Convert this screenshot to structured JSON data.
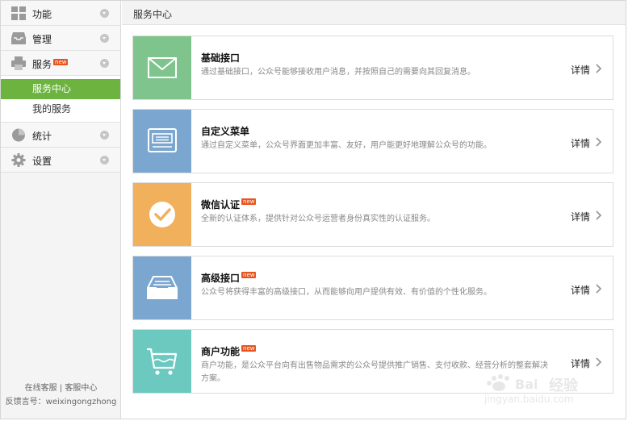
{
  "sidebar": {
    "groups": [
      {
        "label": "功能",
        "icon": "grid-icon"
      },
      {
        "label": "管理",
        "icon": "inbox-icon"
      },
      {
        "label": "服务",
        "icon": "printer-icon",
        "badge": "new"
      },
      {
        "label": "统计",
        "icon": "pie-chart-icon"
      },
      {
        "label": "设置",
        "icon": "gear-icon"
      }
    ],
    "service_items": [
      {
        "label": "服务中心"
      },
      {
        "label": "我的服务"
      }
    ],
    "footer": {
      "online_service": "在线客服",
      "separator": "|",
      "help_center": "客服中心",
      "feedback": "反馈言号：weixingongzhong"
    }
  },
  "header": {
    "title": "服务中心"
  },
  "cards": [
    {
      "name": "基础接口",
      "desc": "通过基础接口，公众号能够接收用户消息，并按照自己的需要向其回复消息。",
      "detail": "详情",
      "color": "#7ec48c",
      "icon": "mail-icon"
    },
    {
      "name": "自定义菜单",
      "desc": "通过自定义菜单，公众号界面更加丰富、友好，用户能更好地理解公众号的功能。",
      "detail": "详情",
      "color": "#7aa6d0",
      "icon": "monitor-icon"
    },
    {
      "name": "微信认证",
      "badge": "new",
      "desc": "全新的认证体系，提供针对公众号运营者身份真实性的认证服务。",
      "detail": "详情",
      "color": "#f0b05c",
      "icon": "check-icon"
    },
    {
      "name": "高级接口",
      "badge": "new",
      "desc": "公众号将获得丰富的高级接口，从而能够向用户提供有效、有价值的个性化服务。",
      "detail": "详情",
      "color": "#7aa6d0",
      "icon": "tray-icon"
    },
    {
      "name": "商户功能",
      "badge": "new",
      "desc": "商户功能，是公众平台向有出售物品需求的公众号提供推广销售、支付收款、经营分析的整套解决方案。",
      "detail": "详情",
      "color": "#6cc9c0",
      "icon": "cart-icon"
    }
  ],
  "watermark": {
    "text": "经验",
    "url": "jingyan.baidu.com"
  }
}
